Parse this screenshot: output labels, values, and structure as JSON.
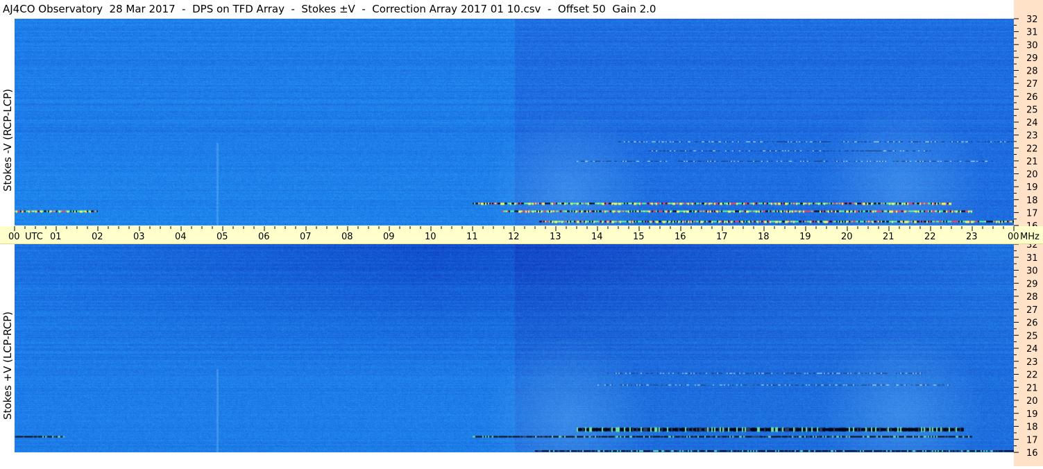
{
  "title": "AJ4CO Observatory  28 Mar 2017  -  DPS on TFD Array  -  Stokes ±V  -  Correction Array 2017 01 10.csv  -  Offset 50  Gain 2.0",
  "chart_data": {
    "type": "heatmap",
    "x_axis": {
      "unit": "UTC",
      "ticks": [
        "00",
        "01",
        "02",
        "03",
        "04",
        "05",
        "06",
        "07",
        "08",
        "09",
        "10",
        "11",
        "12",
        "13",
        "14",
        "15",
        "16",
        "17",
        "18",
        "19",
        "20",
        "21",
        "22",
        "23",
        "00"
      ],
      "range_hours": [
        0,
        24
      ]
    },
    "y_axis": {
      "unit": "MHz",
      "ticks": [
        "16",
        "17",
        "18",
        "19",
        "20",
        "21",
        "22",
        "23",
        "24",
        "25",
        "26",
        "27",
        "28",
        "29",
        "30",
        "31",
        "32"
      ],
      "range_mhz": [
        16,
        32
      ]
    },
    "panels": [
      {
        "name": "top",
        "label": "Stokes -V (RCP-LCP)",
        "features": [
          {
            "kind": "interference-band",
            "freq_mhz": 17.1,
            "start_utc": 0.0,
            "end_utc": 2.0
          },
          {
            "kind": "interference-band",
            "freq_mhz": 17.1,
            "start_utc": 11.7,
            "end_utc": 23.0
          },
          {
            "kind": "interference-band",
            "freq_mhz": 17.7,
            "start_utc": 11.0,
            "end_utc": 22.5
          },
          {
            "kind": "interference-band",
            "freq_mhz": 16.3,
            "start_utc": 12.6,
            "end_utc": 24.0
          },
          {
            "kind": "faint-band",
            "freq_mhz": 21.8,
            "start_utc": 15.2,
            "end_utc": 22.0
          },
          {
            "kind": "faint-band",
            "freq_mhz": 22.5,
            "start_utc": 14.5,
            "end_utc": 24.0
          },
          {
            "kind": "faint-band",
            "freq_mhz": 21.0,
            "start_utc": 13.5,
            "end_utc": 23.5
          }
        ]
      },
      {
        "name": "bottom",
        "label": "Stokes +V (LCP-RCP)",
        "features": [
          {
            "kind": "dark-band",
            "freq_mhz": 17.2,
            "start_utc": 0.0,
            "end_utc": 1.2
          },
          {
            "kind": "dark-band",
            "freq_mhz": 17.75,
            "start_utc": 13.5,
            "end_utc": 22.8
          },
          {
            "kind": "dark-band",
            "freq_mhz": 17.2,
            "start_utc": 11.0,
            "end_utc": 23.0
          },
          {
            "kind": "dark-band",
            "freq_mhz": 16.1,
            "start_utc": 12.5,
            "end_utc": 24.0
          },
          {
            "kind": "faint-band",
            "freq_mhz": 22.1,
            "start_utc": 14.2,
            "end_utc": 21.8
          },
          {
            "kind": "faint-band",
            "freq_mhz": 21.2,
            "start_utc": 14.0,
            "end_utc": 22.5
          }
        ]
      }
    ],
    "colors": {
      "background_blue": "#1e7ee8",
      "dark_blue": "#1050c8",
      "light_cyan": "#50c8ff",
      "yellow": "#ffff40",
      "black": "#000010",
      "axis_band": "#ffffcc",
      "freq_strip": "#ffe2c8"
    }
  }
}
